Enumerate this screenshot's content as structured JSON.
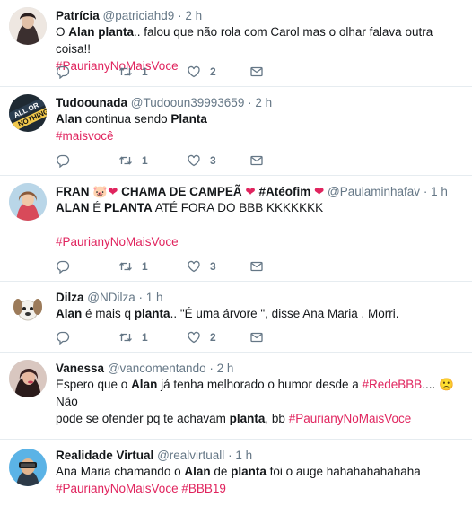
{
  "tweets": [
    {
      "name": "Patrícia",
      "handle": "@patriciahd9",
      "sep": "·",
      "time": "2 h",
      "line1_a": "O ",
      "line1_b": "Alan planta",
      "line1_c": ".. falou que não rola com Carol mas o olhar falava outra coisa!!",
      "hashtags": "#PaurianyNoMaisVoce",
      "retweets": "1",
      "likes": "2"
    },
    {
      "name": "Tudoounada",
      "handle": "@Tudooun39993659",
      "sep": "·",
      "time": "2 h",
      "line1_a": "Alan",
      "line1_b": " continua sendo ",
      "line1_c": "Planta",
      "hashtags": "#maisvocê",
      "retweets": "1",
      "likes": "3"
    },
    {
      "name_a": "FRAN ",
      "name_b": " CHAMA DE CAMPEÃ ",
      "name_c": " #Atéofim ",
      "hearts": "❤",
      "pig": "🐷",
      "handle": "@Paulaminhafav",
      "sep": "·",
      "time": "1 h",
      "line1_a": "ALAN",
      "line1_b": " É ",
      "line1_c": "PLANTA",
      "line1_d": " ATÉ FORA DO BBB KKKKKKK",
      "hashtags": "#PaurianyNoMaisVoce",
      "retweets": "1",
      "likes": "3"
    },
    {
      "name": "Dilza",
      "handle": "@NDilza",
      "sep": "·",
      "time": "1 h",
      "line1_a": "Alan",
      "line1_b": " é  mais q ",
      "line1_c": "planta",
      "line1_d": ".. \"É uma árvore \", disse Ana Maria . Morri.",
      "retweets": "1",
      "likes": "2"
    },
    {
      "name": "Vanessa",
      "handle": "@vancomentando",
      "sep": "·",
      "time": "2 h",
      "line1_a": "Espero que o ",
      "line1_b": "Alan",
      "line1_c": " já tenha melhorado o humor desde a ",
      "line1_tag": "#RedeBBB",
      "line1_d": ".... 🙁Não",
      "line2_a": "pode se ofender pq te achavam ",
      "line2_b": "planta",
      "line2_c": ", bb ",
      "line2_tag": "#PaurianyNoMaisVoce"
    },
    {
      "name": "Realidade Virtual",
      "handle": "@realvirtuall",
      "sep": "·",
      "time": "1 h",
      "line1_a": "Ana Maria chamando o ",
      "line1_b": "Alan",
      "line1_c": " de ",
      "line1_d": "planta",
      "line1_e": " foi o auge hahahahahahaha",
      "hashtags": "#PaurianyNoMaisVoce #BBB19"
    }
  ]
}
